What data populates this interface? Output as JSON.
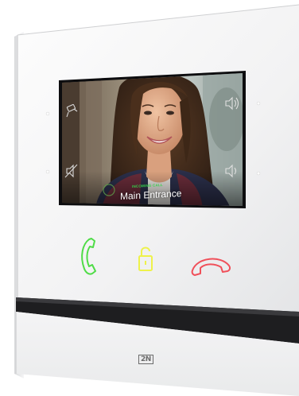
{
  "screen": {
    "status_text": "INCOMING CALL",
    "location_label": "Main Entrance"
  },
  "brand": {
    "logo_text": "2N"
  },
  "icons": {
    "camera": "camera-icon",
    "mute": "mute-icon",
    "volume": "volume-icon",
    "volume_low": "volume-low-icon",
    "answer": "answer-call-icon",
    "lock": "unlock-door-icon",
    "hangup": "hangup-call-icon"
  },
  "colors": {
    "answer": "#4fdc47",
    "lock": "#eef24a",
    "hangup": "#f0505a",
    "status_text": "#35d14a"
  }
}
